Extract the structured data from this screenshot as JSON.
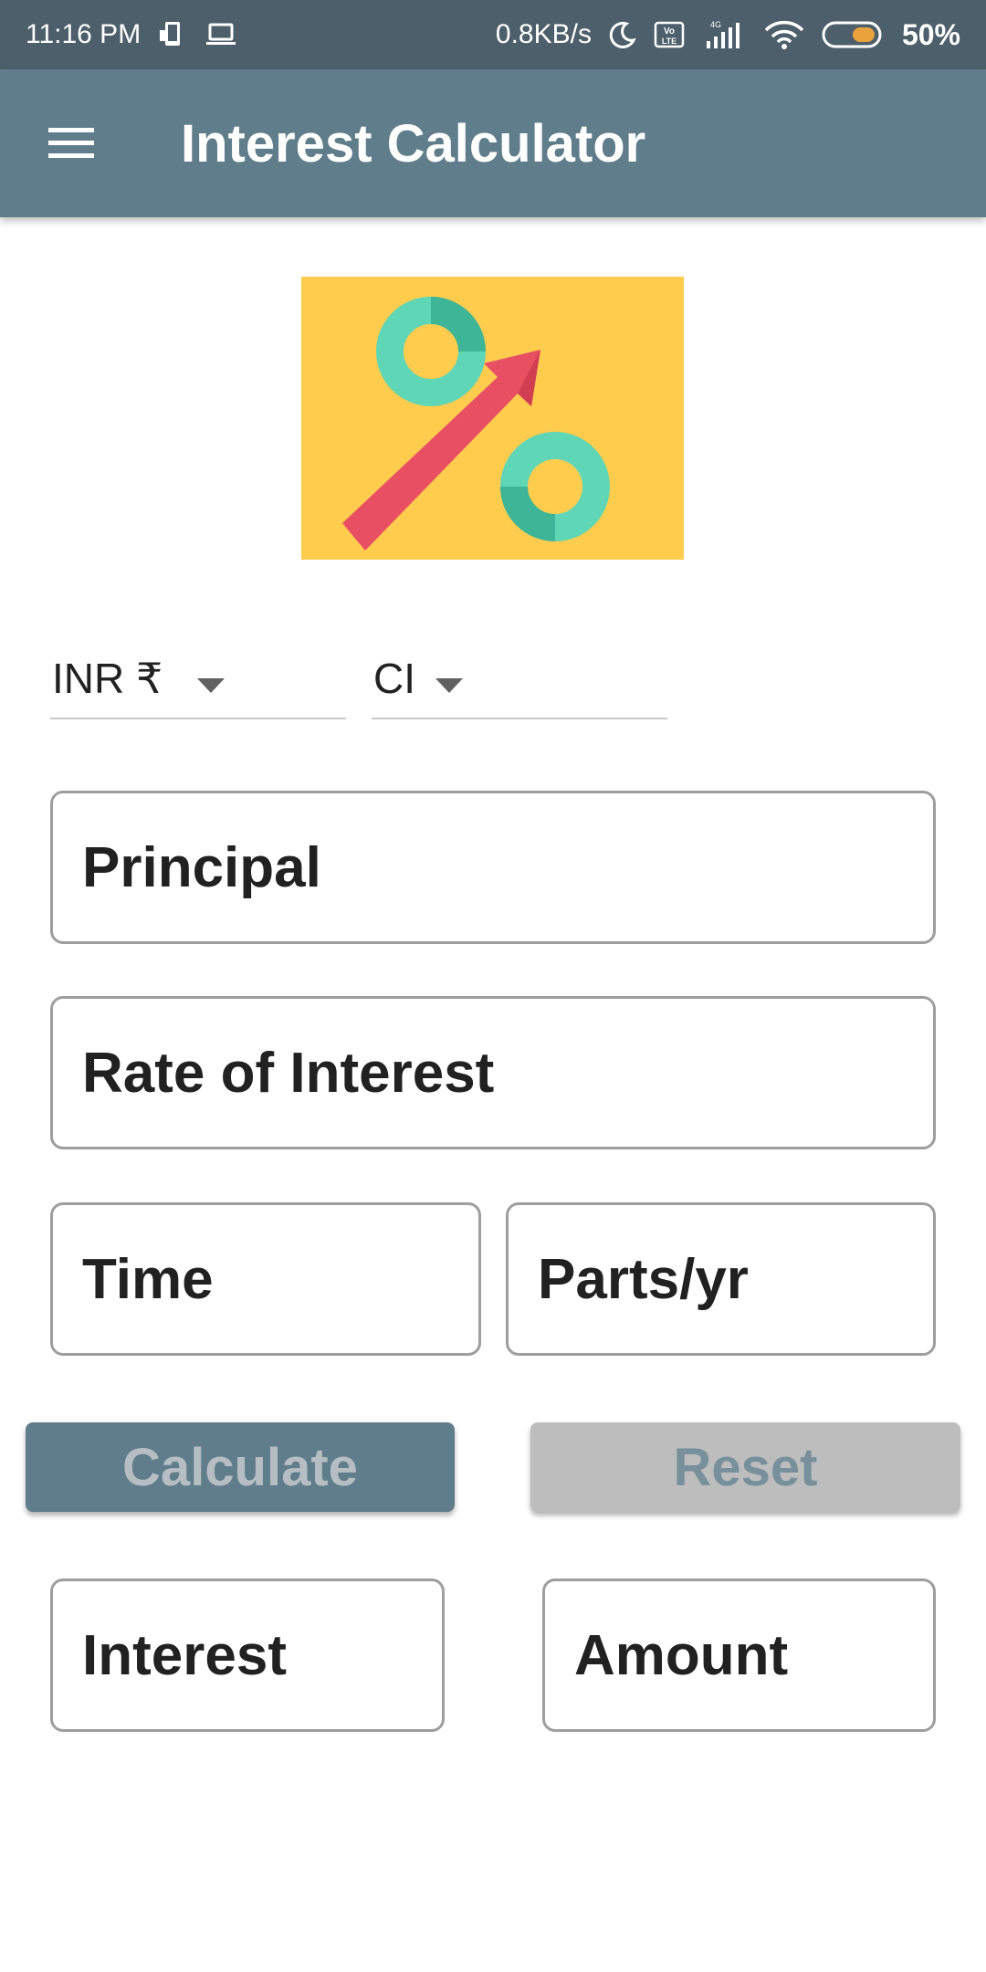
{
  "status_bar": {
    "time": "11:16 PM",
    "net_speed": "0.8KB/s",
    "volte": "Vo LTE",
    "network": "4G",
    "battery": "50%",
    "icons": [
      "phone-icon",
      "laptop-icon",
      "moon-icon",
      "volte-icon",
      "signal-icon",
      "wifi-icon",
      "battery-icon"
    ]
  },
  "app_bar": {
    "title": "Interest Calculator",
    "menu_icon": "hamburger-menu-icon"
  },
  "logo": {
    "icon": "percent-growth-logo",
    "colors": {
      "background": "#ffcc4d",
      "arrow": "#e84f63",
      "ring": "#5fd6b6",
      "ring_dark": "#3eb596"
    }
  },
  "spinners": {
    "currency": "INR ₹",
    "interest_type": "CI"
  },
  "fields": {
    "principal": "Principal",
    "rate": "Rate of Interest",
    "time": "Time",
    "parts": "Parts/yr",
    "interest": "Interest",
    "amount": "Amount"
  },
  "buttons": {
    "calculate": "Calculate",
    "reset": "Reset"
  },
  "colors": {
    "primary": "#607d8b",
    "status_bar": "#4d5f6b",
    "reset_bg": "#bdbdbd"
  }
}
